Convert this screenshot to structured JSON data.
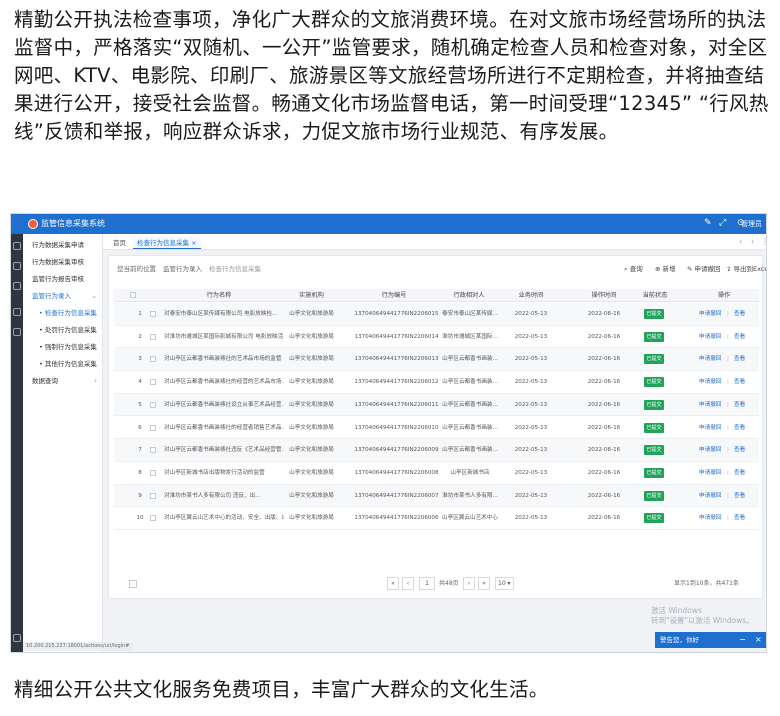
{
  "article": {
    "top": "精勤公开执法检查事项，净化广大群众的文旅消费环境。在对文旅市场经营场所的执法监督中，严格落实“双随机、一公开”监管要求，随机确定检查人员和检查对象，对全区网吧、KTV、电影院、印刷厂、旅游景区等文旅经营场所进行不定期检查，并将抽查结果进行公开，接受社会监督。畅通文化市场监督电话，第一时间受理“12345” “行风热线”反馈和举报，响应群众诉求，力促文旅市场行业规范、有序发展。",
    "bottom": "精细公开公共文化服务免费项目，丰富广大群众的文化生活。"
  },
  "app": {
    "title": "监管信息采集系统",
    "user": "管理员",
    "accent": "#1f6fcf",
    "status_url": "10.200.215.237:18001/actions/url/login#"
  },
  "sidebar": {
    "items": [
      {
        "label": "行为数据采集申请"
      },
      {
        "label": "行为数据采集审核"
      },
      {
        "label": "监管行为报告审核"
      },
      {
        "label": "监管行为录入"
      },
      {
        "label": "检查行为信息采集"
      },
      {
        "label": "处罚行为信息采集"
      },
      {
        "label": "强制行为信息采集"
      },
      {
        "label": "其他行为信息采集"
      },
      {
        "label": "数据查询"
      }
    ]
  },
  "tabs": [
    {
      "label": "首页"
    },
    {
      "label": "检查行为信息采集 ×"
    }
  ],
  "breadcrumb": [
    "您当前的位置",
    "监管行为录入",
    "检查行为信息采集"
  ],
  "toolbar": {
    "search": "查询",
    "add": "新增",
    "report": "申请撤回",
    "export": "导出到Excel"
  },
  "table": {
    "headers": [
      "行为名称",
      "实施机构",
      "行为编号",
      "行政相对人",
      "业务时间",
      "操作时间",
      "当前状态",
      "操作"
    ],
    "rows": [
      {
        "no": "1",
        "name": "对泰安市泰山区某传媒有限公司 电影放映检...",
        "org": "山亭文化和旅游局",
        "code": "137040649441776IN2206015",
        "party": "泰安市泰山区某传媒...",
        "biz": "2022-05-13",
        "op": "2022-06-16",
        "status": "已提交"
      },
      {
        "no": "2",
        "name": "对淮坊市潍城区某国际影城有限公司 电影放映活...",
        "org": "山亭文化和旅游局",
        "code": "137040649441776IN2206014",
        "party": "淮坊市潍城区某国际...",
        "biz": "2022-05-13",
        "op": "2022-06-16",
        "status": "已提交"
      },
      {
        "no": "3",
        "name": "对山亭区云都香书画装裱社的艺术品市场的监管",
        "org": "山亭文化和旅游局",
        "code": "137040649441776IN2206013",
        "party": "山亭区云都香书画装...",
        "biz": "2022-05-13",
        "op": "2022-06-16",
        "status": "已提交"
      },
      {
        "no": "4",
        "name": "对山亭区云都香书画装裱社的经营的艺术品市场...",
        "org": "山亭文化和旅游局",
        "code": "137040649441776IN2206012",
        "party": "山亭区云都香书画装...",
        "biz": "2022-05-13",
        "op": "2022-06-16",
        "status": "已提交"
      },
      {
        "no": "5",
        "name": "对山亭区云都香书画装裱社设立从事艺术品经营...",
        "org": "山亭文化和旅游局",
        "code": "137040649441776IN2206011",
        "party": "山亭区云都香书画装...",
        "biz": "2022-05-13",
        "op": "2022-06-16",
        "status": "已提交"
      },
      {
        "no": "6",
        "name": "对山亭区云都香书画装裱社的经营者销售艺术品...",
        "org": "山亭文化和旅游局",
        "code": "137040649441776IN2206010",
        "party": "山亭区云都香书画装...",
        "biz": "2022-05-13",
        "op": "2022-06-16",
        "status": "已提交"
      },
      {
        "no": "7",
        "name": "对山亭区云都香书画装裱社违反《艺术品经营管...",
        "org": "山亭文化和旅游局",
        "code": "137040649441776IN2206009",
        "party": "山亭区云都香书画装...",
        "biz": "2022-05-13",
        "op": "2022-06-16",
        "status": "已提交"
      },
      {
        "no": "8",
        "name": "对山亭区新城书店出版物发行活动的监管",
        "org": "山亭文化和旅游局",
        "code": "137040649441776IN2206008",
        "party": "山亭区新城书店",
        "biz": "2022-05-13",
        "op": "2022-06-16",
        "status": "已提交"
      },
      {
        "no": "9",
        "name": "对淮坊市某书人多有限公司 违反、出...",
        "org": "山亭文化和旅游局",
        "code": "137040649441776IN2206007",
        "party": "淮坊市某书人多有限...",
        "biz": "2022-05-13",
        "op": "2022-06-16",
        "status": "已提交"
      },
      {
        "no": "10",
        "name": "对山亭区翼云山艺术中心的活动、安全、出版、出...",
        "org": "山亭文化和旅游局",
        "code": "137040649441776IN2206006",
        "party": "山亭区翼云山艺术中心",
        "biz": "2022-05-13",
        "op": "2022-06-16",
        "status": "已提交"
      }
    ],
    "action_edit": "申请撤回",
    "action_view": "查看"
  },
  "pager": {
    "page": "1",
    "total_pages": "共48页",
    "page_size": "10",
    "summary": "显示1到10条，共471条"
  },
  "overlay": {
    "watermark_line1": "激活 Windows",
    "watermark_line2": "转到\"设置\"以激活 Windows。",
    "notify": "警告您，你好"
  }
}
